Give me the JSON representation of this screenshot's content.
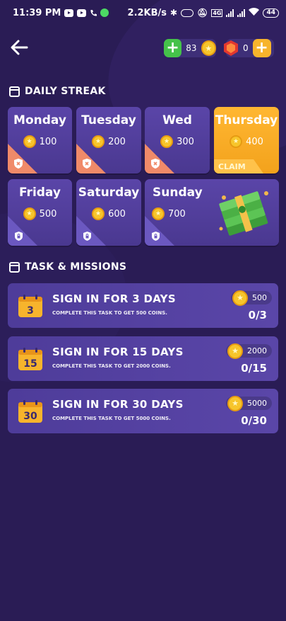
{
  "status_bar": {
    "time": "11:39 PM",
    "net_speed": "2.2KB/s",
    "battery": "44"
  },
  "header": {
    "coin_balance": "83",
    "gem_balance": "0"
  },
  "daily_streak": {
    "title": "DAILY STREAK",
    "days": [
      {
        "name": "Monday",
        "reward": "100",
        "state": "missed"
      },
      {
        "name": "Tuesday",
        "reward": "200",
        "state": "missed"
      },
      {
        "name": "Wed",
        "reward": "300",
        "state": "missed"
      },
      {
        "name": "Thursday",
        "reward": "400",
        "state": "claimable",
        "action": "CLAIM"
      },
      {
        "name": "Friday",
        "reward": "500",
        "state": "locked"
      },
      {
        "name": "Saturday",
        "reward": "600",
        "state": "locked"
      },
      {
        "name": "Sunday",
        "reward": "700",
        "state": "locked"
      }
    ]
  },
  "tasks": {
    "title": "TASK & MISSIONS",
    "items": [
      {
        "badge": "3",
        "title": "SIGN IN FOR 3 DAYS",
        "subtitle": "COMPLETE THIS TASK TO GET 500 COINS.",
        "reward": "500",
        "progress": "0/3"
      },
      {
        "badge": "15",
        "title": "SIGN IN FOR 15 DAYS",
        "subtitle": "COMPLETE THIS TASK TO GET 2000 COINS.",
        "reward": "2000",
        "progress": "0/15"
      },
      {
        "badge": "30",
        "title": "SIGN IN FOR 30 DAYS",
        "subtitle": "COMPLETE THIS TASK TO GET 5000 COINS.",
        "reward": "5000",
        "progress": "0/30"
      }
    ]
  },
  "colors": {
    "background": "#2a1c55",
    "card": "#5a45a8",
    "claim": "#ffb732",
    "missed": "#f08a69",
    "coin": "#f7c52b",
    "add_green": "#45c24a"
  }
}
